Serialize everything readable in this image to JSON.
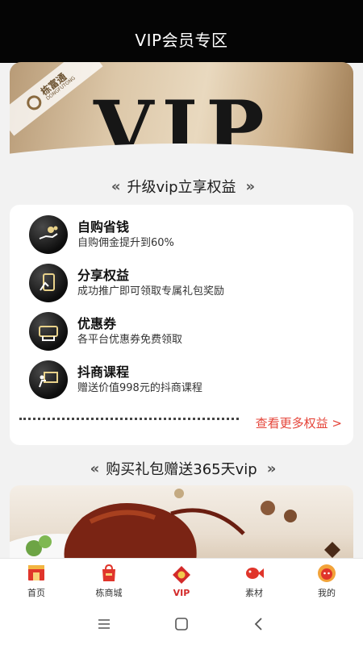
{
  "header": {
    "title": "VIP会员专区"
  },
  "banner": {
    "logo_text": "栋富通",
    "logo_sub": "DONGFUTONG",
    "big_text": "VIP"
  },
  "section1": {
    "title": "升级vip立享权益",
    "chev_left": "«",
    "chev_right": "»"
  },
  "benefits": [
    {
      "name": "自购省钱",
      "desc": "自购佣金提升到60%",
      "icon": "hand-coins-icon"
    },
    {
      "name": "分享权益",
      "desc": "成功推广即可领取专属礼包奖励",
      "icon": "share-card-icon"
    },
    {
      "name": "优惠券",
      "desc": "各平台优惠券免费领取",
      "icon": "coupon-icon"
    },
    {
      "name": "抖商课程",
      "desc": "赠送价值998元的抖商课程",
      "icon": "presentation-icon"
    }
  ],
  "more_link": "查看更多权益 >",
  "section2": {
    "title": "购买礼包赠送365天vip"
  },
  "tabbar": {
    "items": [
      {
        "label": "首页",
        "icon": "home-store-icon"
      },
      {
        "label": "栋商城",
        "icon": "mall-bag-icon"
      },
      {
        "label": "VIP",
        "icon": "vip-envelope-icon"
      },
      {
        "label": "素材",
        "icon": "fish-icon"
      },
      {
        "label": "我的",
        "icon": "lion-face-icon"
      }
    ],
    "active_index": 2
  },
  "colors": {
    "accent": "#e5453a",
    "header_bg": "#050505",
    "tab_active": "#d32a2a"
  }
}
